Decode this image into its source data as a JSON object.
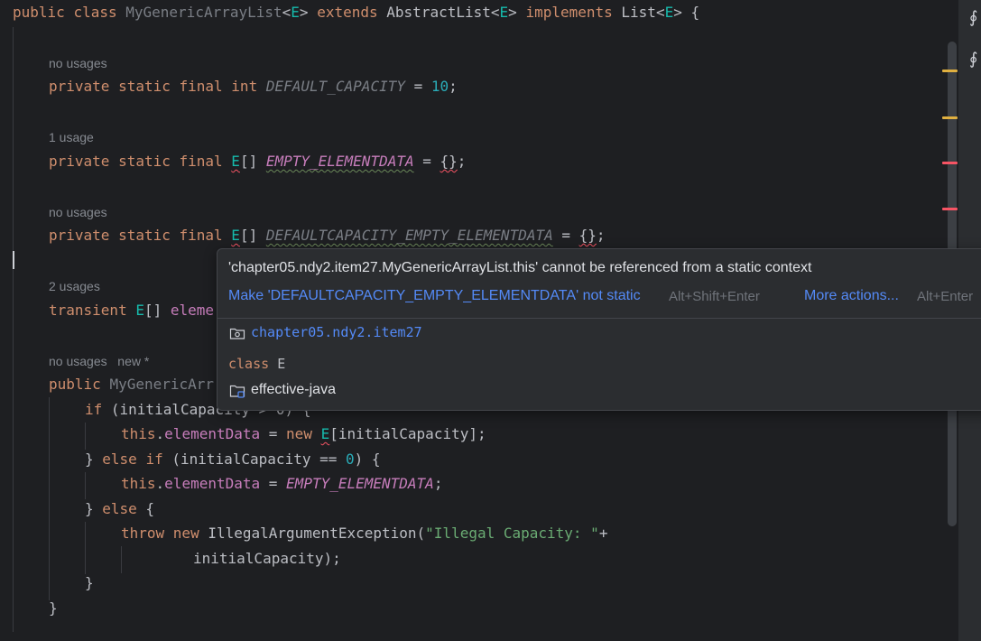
{
  "code": {
    "class_line": {
      "public": "public",
      "class": "class",
      "name": "MyGenericArrayList",
      "lt": "<",
      "E": "E",
      "gt": ">",
      "extends": "extends",
      "super": "AbstractList",
      "implements": "implements",
      "iface": "List",
      "brace": " {"
    },
    "hints": {
      "h1": "no usages",
      "h2": "1 usage",
      "h3": "no usages",
      "h4": "2 usages",
      "h5a": "no usages",
      "h5b": "new *"
    },
    "line_capacity": {
      "mods": "private static final ",
      "int": "int",
      "name": "DEFAULT_CAPACITY",
      "eq": " = ",
      "value": "10",
      "semi": ";"
    },
    "line_empty": {
      "mods": "private static final ",
      "E": "E",
      "arr": "[] ",
      "name": "EMPTY_ELEMENTDATA",
      "eq": " = ",
      "init": "{}",
      "semi": ";"
    },
    "line_default_empty": {
      "mods": "private static final ",
      "E": "E",
      "arr": "[] ",
      "name": "DEFAULTCAPACITY_EMPTY_ELEMENTDATA",
      "eq": " = ",
      "init": "{}",
      "semi": ";"
    },
    "line_transient": {
      "kw": "transient ",
      "E": "E",
      "arr": "[] ",
      "partial": "eleme"
    },
    "line_constructor": {
      "kw": "public ",
      "partial": "MyGenericArr"
    },
    "line_if": {
      "kw": "if",
      "rest": " (initialCapacity > 0) {"
    },
    "line_assign1": {
      "this": "this",
      "dot": ".",
      "field": "elementData",
      "eq": " = ",
      "new": "new ",
      "E": "E",
      "rest": "[initialCapacity];"
    },
    "line_elseif": {
      "close": "} ",
      "else": "else ",
      "if": "if",
      "open": " (initialCapacity == ",
      "zero": "0",
      "end": ") {"
    },
    "line_assign2": {
      "this": "this",
      "dot": ".",
      "field": "elementData",
      "eq": " = ",
      "value": "EMPTY_ELEMENTDATA",
      "semi": ";"
    },
    "line_else": {
      "close": "} ",
      "else": "else",
      "open": " {"
    },
    "line_throw": {
      "throw": "throw ",
      "new": "new ",
      "cls": "IllegalArgumentException(",
      "str": "\"Illegal Capacity: \"",
      "plus": "+"
    },
    "line_arg": {
      "text": "initialCapacity);"
    },
    "line_close_inner": {
      "text": "}"
    },
    "line_close_outer": {
      "text": "}"
    }
  },
  "popup": {
    "message": "'chapter05.ndy2.item27.MyGenericArrayList.this' cannot be referenced from a static context",
    "fix_action": "Make 'DEFAULTCAPACITY_EMPTY_ELEMENTDATA' not static",
    "fix_shortcut": "Alt+Shift+Enter",
    "more_actions": "More actions...",
    "more_shortcut": "Alt+Enter",
    "package": "chapter05.ndy2.item27",
    "declaration": "class E",
    "module": "effective-java"
  },
  "colors": {
    "background": "#1e1f22",
    "keyword": "#cf8e6d",
    "type_param": "#16baac",
    "number": "#2aacb8",
    "static_field": "#c77dbb",
    "string": "#6aab73",
    "link": "#548af7",
    "error_mark": "#f75464",
    "warning_mark": "#e0b040"
  },
  "icons": {
    "package": "package-icon",
    "module": "module-folder-icon",
    "side": [
      "ai-assistant-icon",
      "ai-assistant-icon"
    ]
  }
}
